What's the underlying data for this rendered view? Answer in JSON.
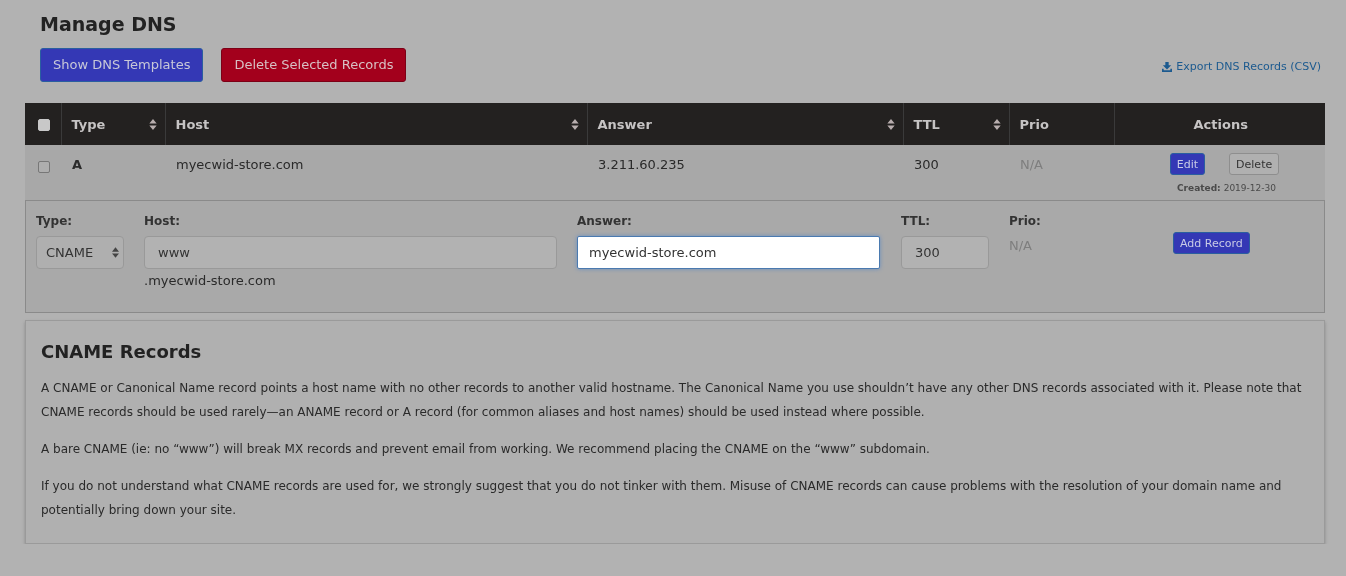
{
  "title": "Manage DNS",
  "buttons": [
    {
      "label": "Show DNS Templates",
      "kind": "primary"
    },
    {
      "label": "Delete Selected Records",
      "kind": "danger"
    }
  ],
  "export_link": "Export DNS Records (CSV)",
  "table": {
    "select_all": {
      "checked": false
    },
    "columns": [
      {
        "label": "Type",
        "sortable": true
      },
      {
        "label": "Host",
        "sortable": true
      },
      {
        "label": "Answer",
        "sortable": true
      },
      {
        "label": "TTL",
        "sortable": true
      },
      {
        "label": "Prio",
        "sortable": false
      },
      {
        "label": "Actions",
        "sortable": false
      }
    ],
    "rows": [
      {
        "checked": false,
        "type": "A",
        "host": "myecwid-store.com",
        "answer": "3.211.60.235",
        "ttl": "300",
        "prio": "N/A",
        "actions": [
          {
            "label": "Edit",
            "kind": "primary"
          },
          {
            "label": "Delete",
            "kind": "plain"
          }
        ],
        "created_label": "Created:",
        "created_date": "2019-12-30"
      }
    ]
  },
  "new_record": {
    "type_label": "Type:",
    "type_value": "CNAME",
    "host_label": "Host:",
    "host_value": "www",
    "host_suffix": ".myecwid-store.com",
    "answer_label": "Answer:",
    "answer_value": "myecwid-store.com",
    "ttl_label": "TTL:",
    "ttl_value": "300",
    "prio_label": "Prio:",
    "prio_value": "N/A",
    "submit": "Add Record"
  },
  "info": {
    "title": "CNAME Records",
    "paragraphs": [
      "A CNAME or Canonical Name record points a host name with no other records to another valid hostname. The Canonical Name you use shouldn’t have any other DNS records associated with it. Please note that CNAME records should be used rarely—an ANAME record or A record (for common aliases and host names) should be used instead where possible.",
      "A bare CNAME (ie: no “www”) will break MX records and prevent email from working. We recommend placing the CNAME on the “www” subdomain.",
      "If you do not understand what CNAME records are used for, we strongly suggest that you do not tinker with them. Misuse of CNAME records can cause problems with the resolution of your domain name and potentially bring down your site."
    ]
  }
}
